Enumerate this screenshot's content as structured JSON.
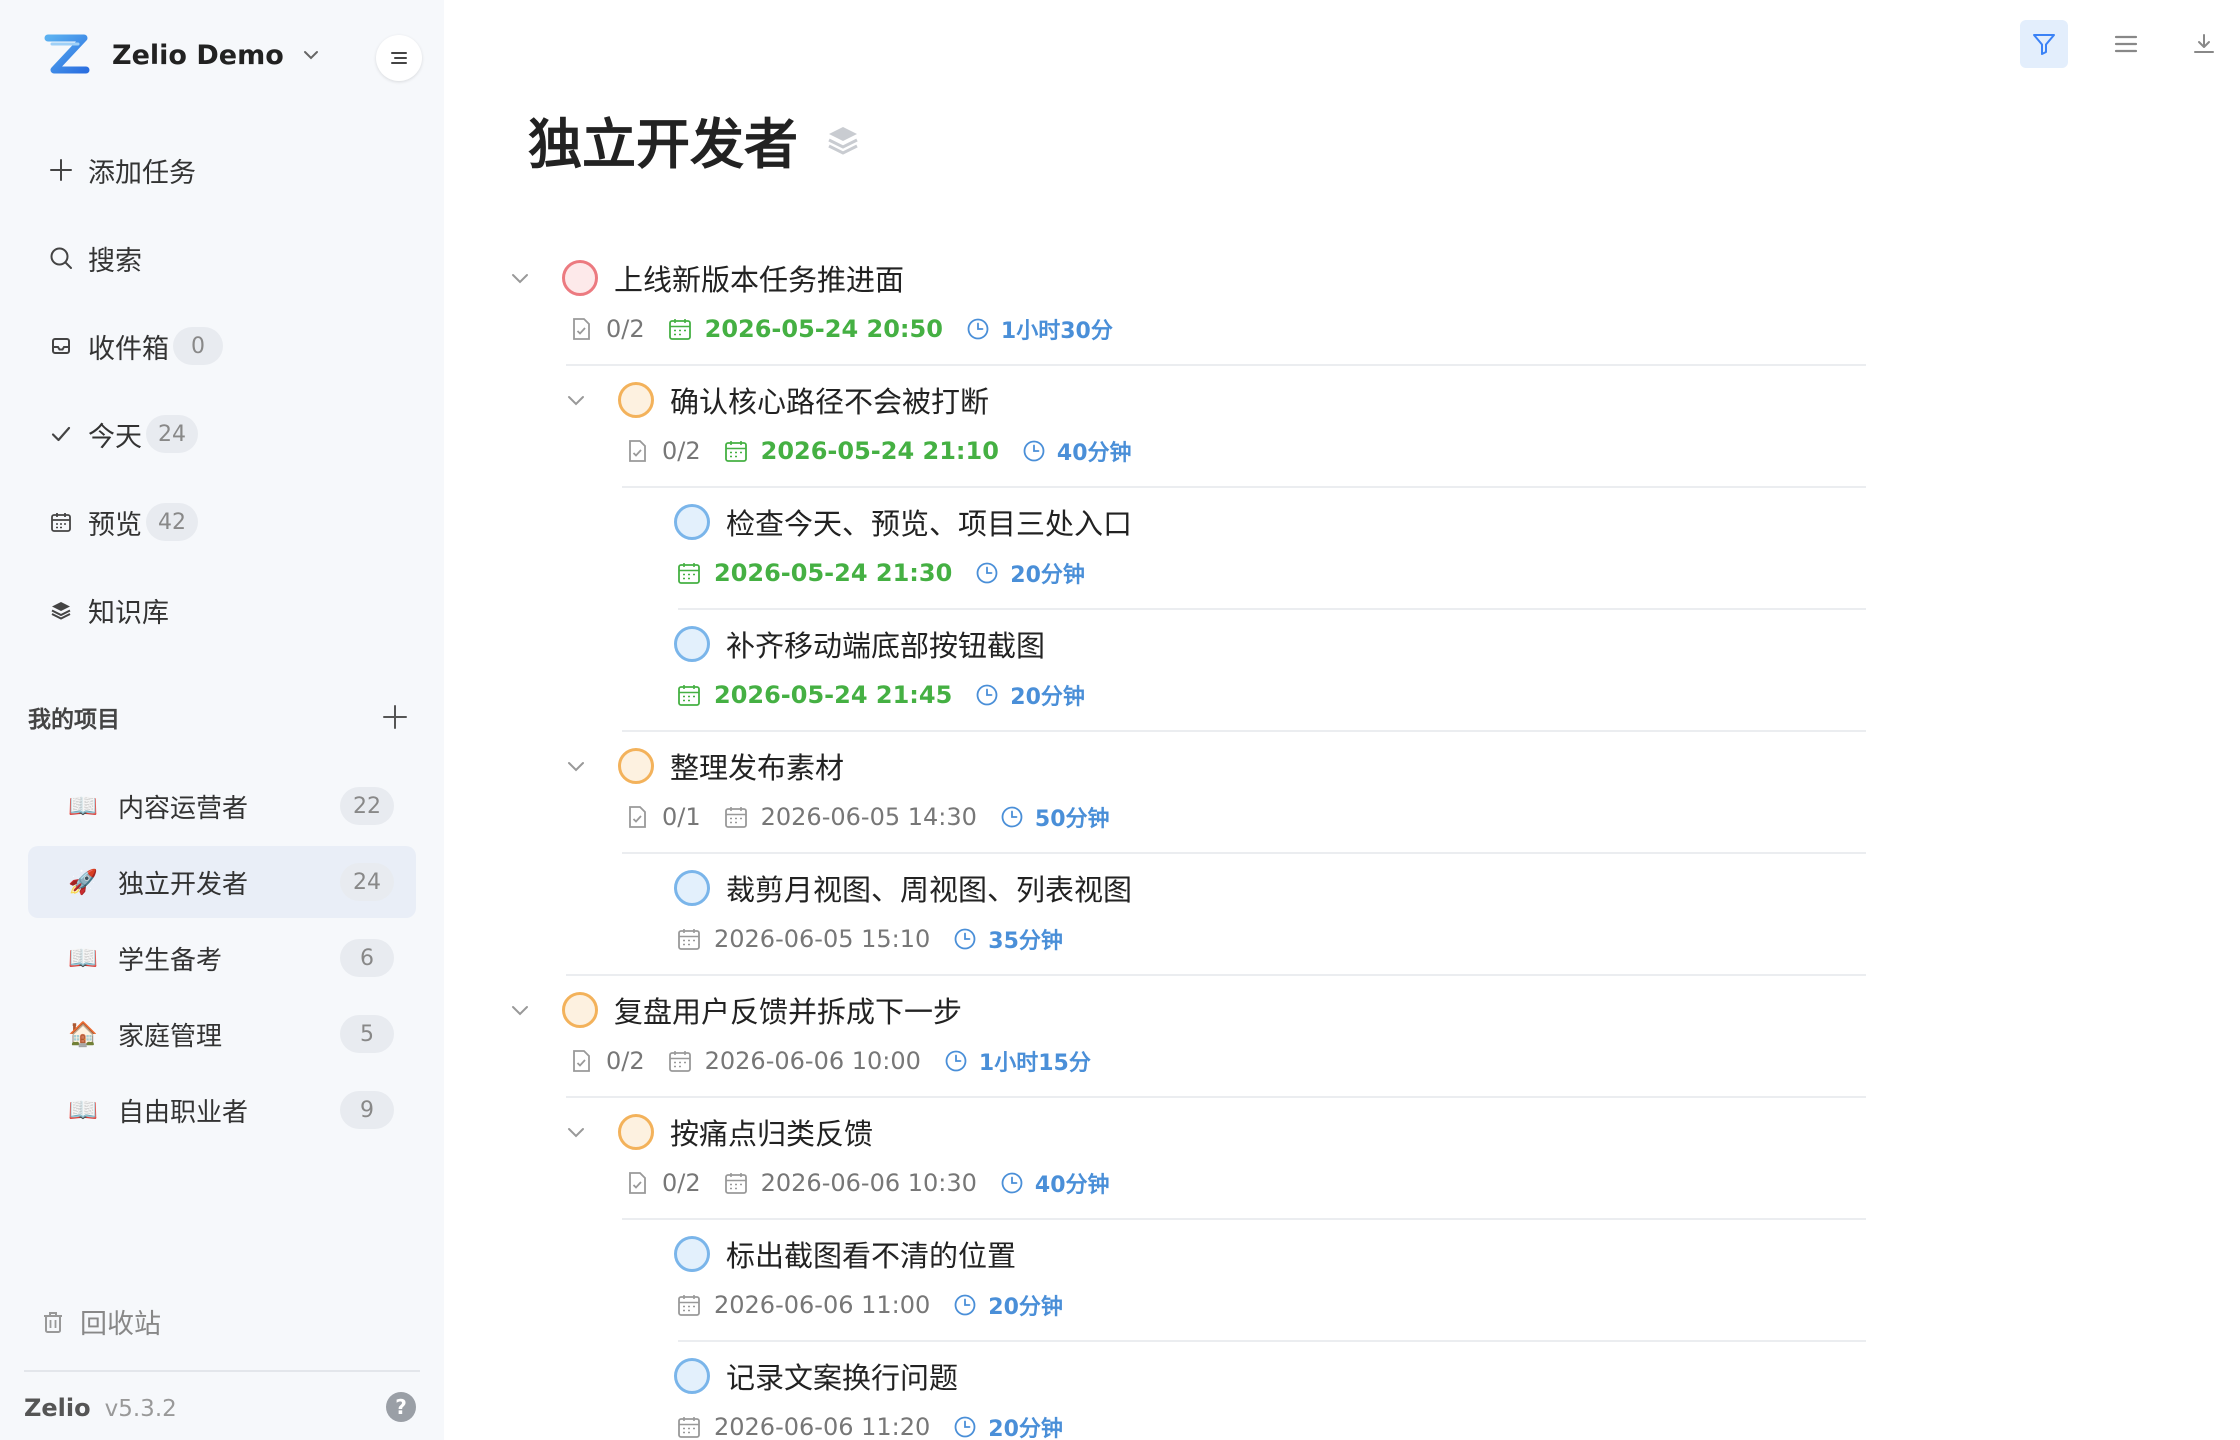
{
  "workspace": {
    "name": "Zelio Demo"
  },
  "nav": {
    "add_task": "添加任务",
    "search": "搜索",
    "inbox": "收件箱",
    "inbox_count": "0",
    "today": "今天",
    "today_count": "24",
    "preview": "预览",
    "preview_count": "42",
    "knowledge": "知识库"
  },
  "projects": {
    "title": "我的项目",
    "items": [
      {
        "emoji": "📖",
        "label": "内容运营者",
        "count": "22"
      },
      {
        "emoji": "🚀",
        "label": "独立开发者",
        "count": "24",
        "active": true
      },
      {
        "emoji": "📖",
        "label": "学生备考",
        "count": "6"
      },
      {
        "emoji": "🏠",
        "label": "家庭管理",
        "count": "5"
      },
      {
        "emoji": "📖",
        "label": "自由职业者",
        "count": "9"
      }
    ]
  },
  "trash": "回收站",
  "footer": {
    "brand": "Zelio",
    "version": "v5.3.2",
    "help": "?"
  },
  "page": {
    "title": "独立开发者"
  },
  "colors": {
    "accent": "#4a8fd8",
    "due_today": "#45b043",
    "priority_high": "#ec7a80",
    "priority_medium": "#f3b25b",
    "priority_low": "#7ab5ea"
  },
  "tasks": [
    {
      "title": "上线新版本任务推进面",
      "progress": "0/2",
      "date": "2026-05-24 20:50",
      "duration": "1小时30分",
      "priority": "high",
      "date_style": "green"
    },
    {
      "title": "确认核心路径不会被打断",
      "progress": "0/2",
      "date": "2026-05-24 21:10",
      "duration": "40分钟",
      "priority": "medium",
      "date_style": "green"
    },
    {
      "title": "检查今天、预览、项目三处入口",
      "date": "2026-05-24 21:30",
      "duration": "20分钟",
      "priority": "low",
      "date_style": "green"
    },
    {
      "title": "补齐移动端底部按钮截图",
      "date": "2026-05-24 21:45",
      "duration": "20分钟",
      "priority": "low",
      "date_style": "green"
    },
    {
      "title": "整理发布素材",
      "progress": "0/1",
      "date": "2026-06-05 14:30",
      "duration": "50分钟",
      "priority": "medium",
      "date_style": "gray"
    },
    {
      "title": "裁剪月视图、周视图、列表视图",
      "date": "2026-06-05 15:10",
      "duration": "35分钟",
      "priority": "low",
      "date_style": "gray"
    },
    {
      "title": "复盘用户反馈并拆成下一步",
      "progress": "0/2",
      "date": "2026-06-06 10:00",
      "duration": "1小时15分",
      "priority": "medium",
      "date_style": "gray"
    },
    {
      "title": "按痛点归类反馈",
      "progress": "0/2",
      "date": "2026-06-06 10:30",
      "duration": "40分钟",
      "priority": "medium",
      "date_style": "gray"
    },
    {
      "title": "标出截图看不清的位置",
      "date": "2026-06-06 11:00",
      "duration": "20分钟",
      "priority": "low",
      "date_style": "gray"
    },
    {
      "title": "记录文案换行问题",
      "date": "2026-06-06 11:20",
      "duration": "20分钟",
      "priority": "low",
      "date_style": "gray"
    }
  ]
}
